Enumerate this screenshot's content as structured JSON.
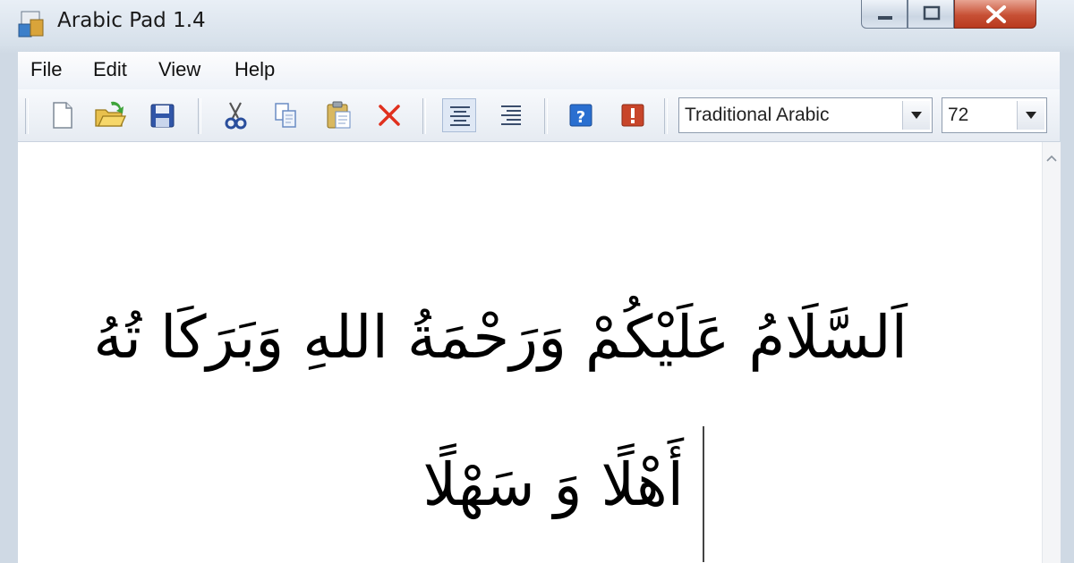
{
  "window": {
    "title": "Arabic Pad 1.4"
  },
  "menubar": {
    "items": [
      {
        "label": "File"
      },
      {
        "label": "Edit"
      },
      {
        "label": "View"
      },
      {
        "label": "Help"
      }
    ]
  },
  "toolbar": {
    "buttons": [
      {
        "icon": "new-document-icon"
      },
      {
        "icon": "open-folder-icon"
      },
      {
        "icon": "save-icon"
      },
      {
        "icon": "cut-icon"
      },
      {
        "icon": "copy-icon"
      },
      {
        "icon": "paste-icon"
      },
      {
        "icon": "delete-icon"
      },
      {
        "icon": "align-center-icon"
      },
      {
        "icon": "align-right-icon"
      },
      {
        "icon": "help-icon"
      },
      {
        "icon": "about-icon"
      }
    ],
    "font_select": {
      "value": "Traditional Arabic"
    },
    "size_select": {
      "value": "72"
    }
  },
  "editor": {
    "lines": [
      "اَلسَّلَامُ عَلَيْكُمْ وَرَحْمَةُ اللهِ وَبَرَكَا تُهُ",
      "أَهْلًا وَ سَهْلًا"
    ]
  },
  "colors": {
    "close_button": "#c75035",
    "help_blue": "#2a6fd0",
    "about_red": "#c8452a",
    "delete_red": "#e0301e"
  }
}
